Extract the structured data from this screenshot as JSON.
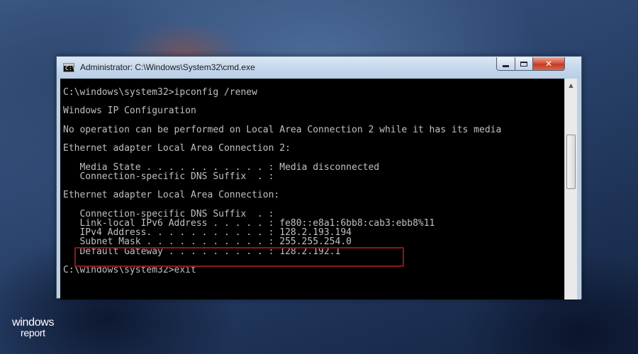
{
  "window": {
    "title": "Administrator: C:\\Windows\\System32\\cmd.exe",
    "icon_text": "C:\\",
    "controls": {
      "minimize_icon": "minimize-icon",
      "maximize_icon": "maximize-icon",
      "close_icon": "close-icon",
      "close_label": "✕"
    }
  },
  "console": {
    "lines": [
      "C:\\windows\\system32>ipconfig /renew",
      "Windows IP Configuration",
      "No operation can be performed on Local Area Connection 2 while it has its media",
      "Ethernet adapter Local Area Connection 2:",
      "   Media State . . . . . . . . . . . : Media disconnected",
      "   Connection-specific DNS Suffix  . :",
      "Ethernet adapter Local Area Connection:",
      "   Connection-specific DNS Suffix  . :",
      "   Link-local IPv6 Address . . . . . : fe80::e8a1:6bb8:cab3:ebb8%11",
      "   IPv4 Address. . . . . . . . . . . : 128.2.193.194",
      "   Subnet Mask . . . . . . . . . . . : 255.255.254.0",
      "   Default Gateway . . . . . . . . . : 128.2.192.1",
      "C:\\windows\\system32>exit"
    ],
    "text_color": "#c0c0c0",
    "background_color": "#000000",
    "highlight_color": "#8a1a1a"
  },
  "branding": {
    "logo_main": "windows",
    "logo_sub": "report"
  }
}
